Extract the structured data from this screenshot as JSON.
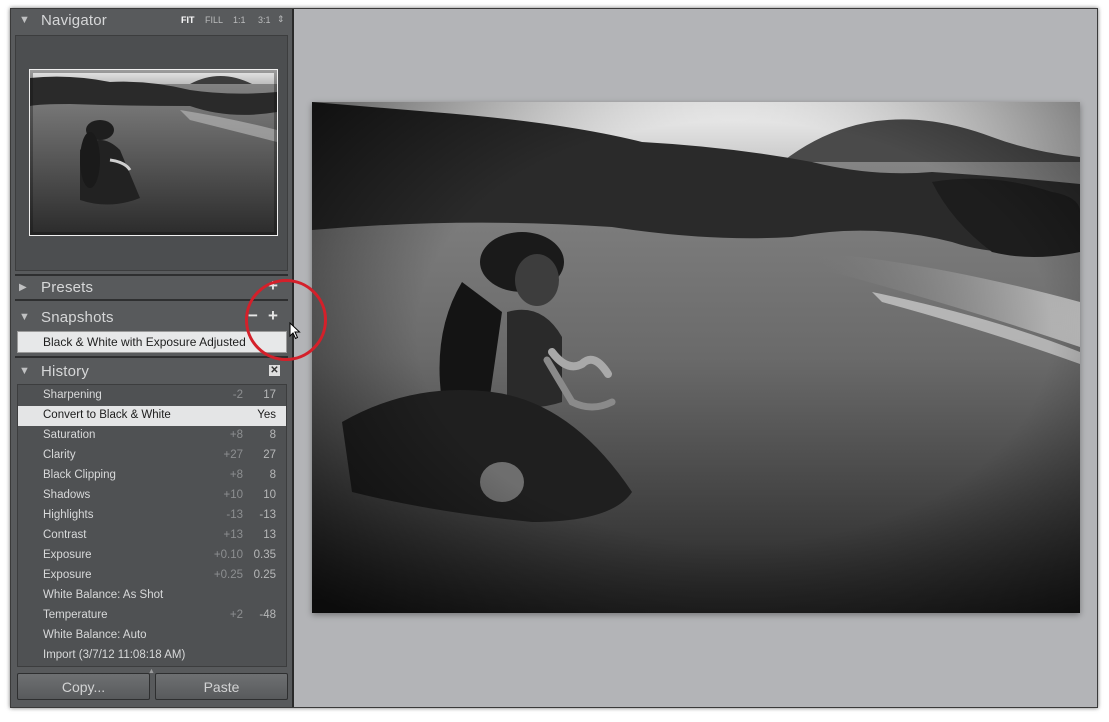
{
  "navigator": {
    "title": "Navigator",
    "zoom_options": [
      "FIT",
      "FILL",
      "1:1",
      "3:1"
    ],
    "active_zoom": "FIT",
    "zoom_arrow": "⇕"
  },
  "presets": {
    "title": "Presets",
    "add_icon": "plus-icon"
  },
  "snapshots": {
    "title": "Snapshots",
    "items": [
      "Black & White with Exposure Adjusted"
    ]
  },
  "history": {
    "title": "History",
    "close_icon": "x-icon",
    "items": [
      {
        "label": "Sharpening",
        "before": "-2",
        "after": "17"
      },
      {
        "label": "Convert to Black & White",
        "before": "",
        "after": "Yes",
        "selected": true
      },
      {
        "label": "Saturation",
        "before": "+8",
        "after": "8"
      },
      {
        "label": "Clarity",
        "before": "+27",
        "after": "27"
      },
      {
        "label": "Black Clipping",
        "before": "+8",
        "after": "8"
      },
      {
        "label": "Shadows",
        "before": "+10",
        "after": "10"
      },
      {
        "label": "Highlights",
        "before": "-13",
        "after": "-13"
      },
      {
        "label": "Contrast",
        "before": "+13",
        "after": "13"
      },
      {
        "label": "Exposure",
        "before": "+0.10",
        "after": "0.35"
      },
      {
        "label": "Exposure",
        "before": "+0.25",
        "after": "0.25"
      },
      {
        "label": "White Balance: As Shot",
        "before": "",
        "after": ""
      },
      {
        "label": "Temperature",
        "before": "+2",
        "after": "-48"
      },
      {
        "label": "White Balance: Auto",
        "before": "",
        "after": ""
      },
      {
        "label": "Import (3/7/12 11:08:18 AM)",
        "before": "",
        "after": ""
      }
    ]
  },
  "buttons": {
    "copy": "Copy...",
    "paste": "Paste"
  },
  "colors": {
    "callout": "#d4202a",
    "panel": "#585a5c",
    "canvas": "#b3b4b7"
  }
}
